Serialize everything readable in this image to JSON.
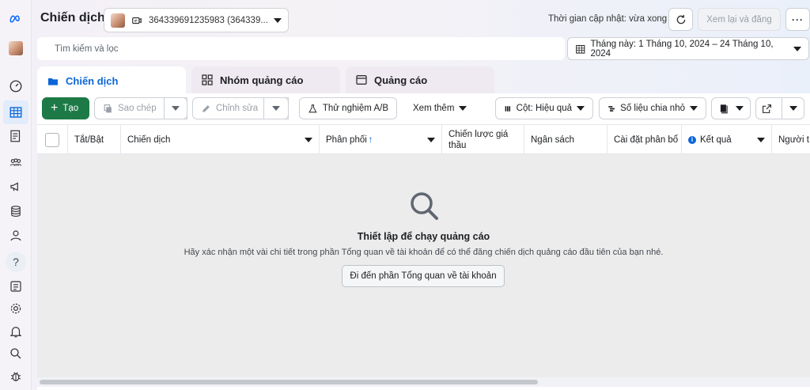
{
  "app": {
    "title": "Chiến dịch"
  },
  "account": {
    "id_text": "364339691235983 (364339..."
  },
  "header": {
    "updated_text": "Thời gian cập nhật: vừa xong",
    "review_label": "Xem lại và đăng",
    "more_label": "···"
  },
  "search": {
    "placeholder": "Tìm kiếm và lọc"
  },
  "date_range": {
    "label": "Tháng này: 1 Tháng 10, 2024 – 24 Tháng 10, 2024"
  },
  "tabs": [
    {
      "label": "Chiến dịch",
      "active": true
    },
    {
      "label": "Nhóm quảng cáo",
      "active": false
    },
    {
      "label": "Quảng cáo",
      "active": false
    }
  ],
  "toolbar": {
    "create_label": "Tạo",
    "copy_label": "Sao chép",
    "edit_label": "Chỉnh sửa",
    "ab_test_label": "Thử nghiệm A/B",
    "see_more_label": "Xem thêm",
    "columns_label": "Cột: Hiệu quả",
    "breakdown_label": "Số liệu chia nhỏ"
  },
  "table": {
    "columns": [
      "Tắt/Bật",
      "Chiến dịch",
      "Phân phối",
      "Chiến lược giá thầu",
      "Ngân sách",
      "Cài đặt phân bổ",
      "Kết quả",
      "Người t"
    ],
    "sort_indicator": "↑"
  },
  "empty_state": {
    "title": "Thiết lập để chạy quảng cáo",
    "description": "Hãy xác nhận một vài chi tiết trong phần Tổng quan về tài khoản để có thể đăng chiến dịch quảng cáo đầu tiên của bạn nhé.",
    "button_label": "Đi đến phần Tổng quan về tài khoản"
  },
  "rail": {
    "help_label": "?"
  },
  "colors": {
    "accent": "#0a66d8",
    "primary_button": "#1d7a46"
  }
}
